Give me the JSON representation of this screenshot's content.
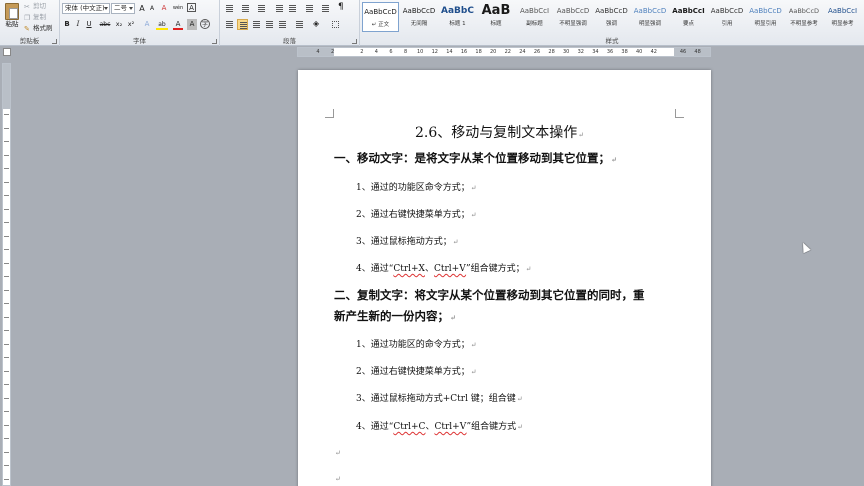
{
  "ribbon": {
    "clipboard": {
      "label": "剪贴板",
      "paste": "粘贴",
      "cut": "剪切",
      "copy": "复制",
      "format_painter": "格式刷"
    },
    "font": {
      "label": "字体",
      "font_name": "宋体 (中文正)",
      "font_size": "二号",
      "grow_glyph": "A",
      "shrink_glyph": "A",
      "clear_glyph": "A",
      "pinyin_glyph": "wén",
      "border_glyph": "A",
      "bold": "B",
      "italic": "I",
      "underline": "U",
      "strike": "abc",
      "subscript": "x₂",
      "superscript": "x²",
      "effects_glyph": "A",
      "highlight_glyph": "ab",
      "color_glyph": "A",
      "shading_glyph": "A",
      "circle_glyph": "字"
    },
    "paragraph": {
      "label": "段落"
    },
    "styles": {
      "label": "样式",
      "items": [
        {
          "sample": "AaBbCcD",
          "name": "↵ 正文",
          "active": true
        },
        {
          "sample": "AaBbCcD",
          "name": "无间隔",
          "active": false
        },
        {
          "sample": "AaBbC",
          "name": "标题 1",
          "active": false
        },
        {
          "sample": "AaB",
          "name": "标题",
          "active": false
        },
        {
          "sample": "AaBbCcI",
          "name": "副标题",
          "active": false
        },
        {
          "sample": "AaBbCcD",
          "name": "不明显强调",
          "active": false
        },
        {
          "sample": "AaBbCcD",
          "name": "强调",
          "active": false
        },
        {
          "sample": "AaBbCcD",
          "name": "明显强调",
          "active": false
        },
        {
          "sample": "AaBbCcI",
          "name": "要点",
          "active": false
        },
        {
          "sample": "AaBbCcD",
          "name": "引用",
          "active": false
        },
        {
          "sample": "AaBbCcD",
          "name": "明显引用",
          "active": false
        },
        {
          "sample": "AaBbCcD",
          "name": "不明显参考",
          "active": false
        },
        {
          "sample": "AaBbCcI",
          "name": "明显参考",
          "active": false
        }
      ]
    }
  },
  "ruler": {
    "ticks": [
      "4",
      "2",
      "",
      "2",
      "4",
      "6",
      "8",
      "10",
      "12",
      "14",
      "16",
      "18",
      "20",
      "22",
      "24",
      "26",
      "28",
      "30",
      "32",
      "34",
      "36",
      "38",
      "40",
      "42",
      "",
      "46",
      "48"
    ]
  },
  "document": {
    "title": "2.6、移动与复制文本操作",
    "h1": "一、移动文字：是将文字从某个位置移动到其它位置；",
    "m1": "1、通过的功能区命令方式；",
    "m2": "2、通过右键快捷菜单方式；",
    "m3": "3、通过鼠标拖动方式；",
    "m4_pre": "4、通过“",
    "m4_k1": "Ctrl+X",
    "m4_sep": "、",
    "m4_k2": "Ctrl+V",
    "m4_post": "”组合键方式；",
    "h2_l1": "二、复制文字：将文字从某个位置移动到其它位置的同时，重",
    "h2_l2": "新产生新的一份内容；",
    "c1": "1、通过功能区的命令方式；",
    "c2": "2、通过右键快捷菜单方式；",
    "c3": "3、通过鼠标拖动方式+Ctrl 键；组合键",
    "c4_pre": "4、通过“",
    "c4_k1": "Ctrl+C",
    "c4_sep": "、",
    "c4_k2": "Ctrl+V",
    "c4_post": "”组合键方式",
    "para_mark": "↵"
  },
  "colors": {
    "ribbon_bg": "#e4e8ee",
    "workspace": "#a9aeb6",
    "spell_underline": "#dd3333",
    "active_style_border": "#7fa3cf"
  }
}
